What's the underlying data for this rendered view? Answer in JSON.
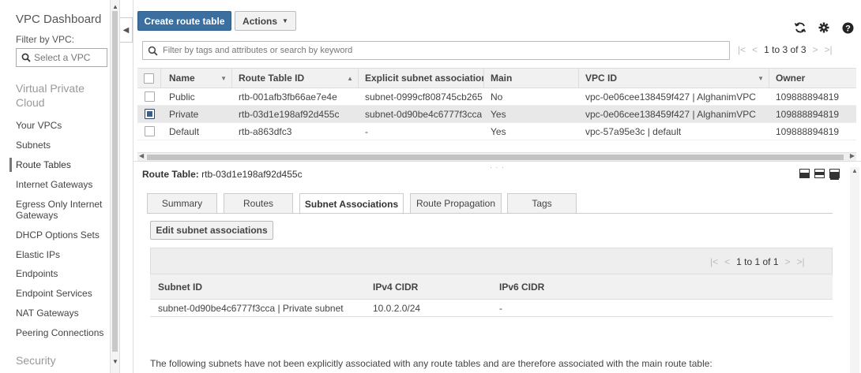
{
  "sidebar": {
    "title": "VPC Dashboard",
    "filter_label": "Filter by VPC:",
    "select_placeholder": "Select a VPC",
    "section_vpc": "Virtual Private Cloud",
    "items": [
      {
        "label": "Your VPCs"
      },
      {
        "label": "Subnets"
      },
      {
        "label": "Route Tables"
      },
      {
        "label": "Internet Gateways"
      },
      {
        "label": "Egress Only Internet Gateways"
      },
      {
        "label": "DHCP Options Sets"
      },
      {
        "label": "Elastic IPs"
      },
      {
        "label": "Endpoints"
      },
      {
        "label": "Endpoint Services"
      },
      {
        "label": "NAT Gateways"
      },
      {
        "label": "Peering Connections"
      }
    ],
    "section_security": "Security",
    "active_item": "Route Tables"
  },
  "toolbar": {
    "create_label": "Create route table",
    "actions_label": "Actions"
  },
  "filter": {
    "placeholder": "Filter by tags and attributes or search by keyword"
  },
  "pager": {
    "text": "1 to 3 of 3"
  },
  "table": {
    "columns": [
      "Name",
      "Route Table ID",
      "Explicit subnet association",
      "Main",
      "VPC ID",
      "Owner"
    ],
    "rows": [
      {
        "name": "Public",
        "id": "rtb-001afb3fb66ae7e4e",
        "subnet": "subnet-0999cf808745cb265",
        "main": "No",
        "vpc": "vpc-0e06cee138459f427 | AlghanimVPC",
        "owner": "109888894819",
        "selected": false
      },
      {
        "name": "Private",
        "id": "rtb-03d1e198af92d455c",
        "subnet": "subnet-0d90be4c6777f3cca",
        "main": "Yes",
        "vpc": "vpc-0e06cee138459f427 | AlghanimVPC",
        "owner": "109888894819",
        "selected": true
      },
      {
        "name": "Default",
        "id": "rtb-a863dfc3",
        "subnet": "-",
        "main": "Yes",
        "vpc": "vpc-57a95e3c | default",
        "owner": "109888894819",
        "selected": false
      }
    ]
  },
  "detail": {
    "label": "Route Table:",
    "value": "rtb-03d1e198af92d455c",
    "tabs": [
      "Summary",
      "Routes",
      "Subnet Associations",
      "Route Propagation",
      "Tags"
    ],
    "active_tab": "Subnet Associations",
    "edit_label": "Edit subnet associations",
    "pager_text": "1 to 1 of 1",
    "columns": [
      "Subnet ID",
      "IPv4 CIDR",
      "IPv6 CIDR"
    ],
    "rows": [
      {
        "subnet": "subnet-0d90be4c6777f3cca | Private subnet",
        "ipv4": "10.0.2.0/24",
        "ipv6": "-"
      }
    ],
    "note": "The following subnets have not been explicitly associated with any route tables and are therefore associated with the main route table:"
  }
}
